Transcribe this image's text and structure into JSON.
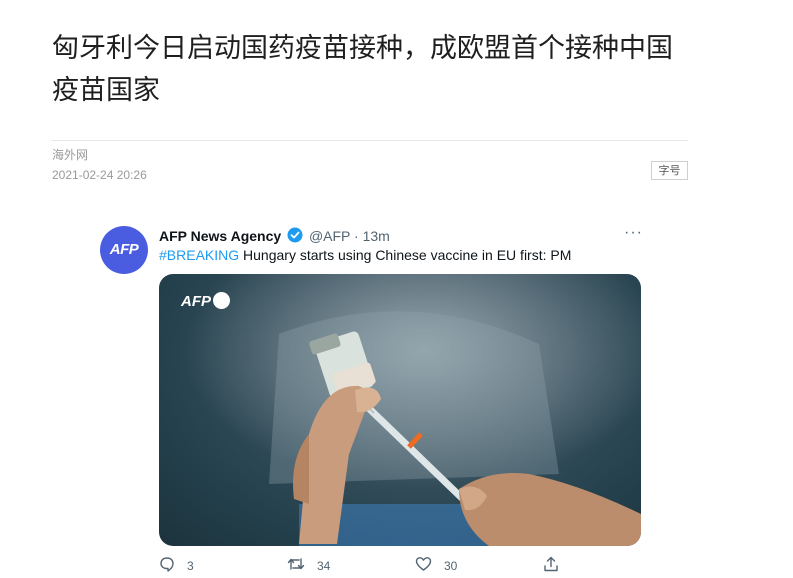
{
  "article": {
    "title": "匈牙利今日启动国药疫苗接种，成欧盟首个接种中国疫苗国家",
    "source": "海外网",
    "date": "2021-02-24 20:26",
    "font_size_button": "字号"
  },
  "tweet": {
    "avatar_text": "AFP",
    "author": "AFP News Agency",
    "handle": "@AFP",
    "separator": "·",
    "time": "13m",
    "more": "···",
    "hashtag": "#BREAKING",
    "text": " Hungary starts using Chinese vaccine in EU first: PM",
    "media_watermark": "AFP",
    "actions": {
      "replies": "3",
      "retweets": "34",
      "likes": "30"
    }
  },
  "colors": {
    "brand_blue": "#4a5ce0",
    "link_blue": "#1d9bf0",
    "muted": "#536471"
  },
  "icons": [
    "verified-badge-icon",
    "more-options-icon",
    "reply-icon",
    "retweet-icon",
    "like-icon",
    "share-icon"
  ]
}
